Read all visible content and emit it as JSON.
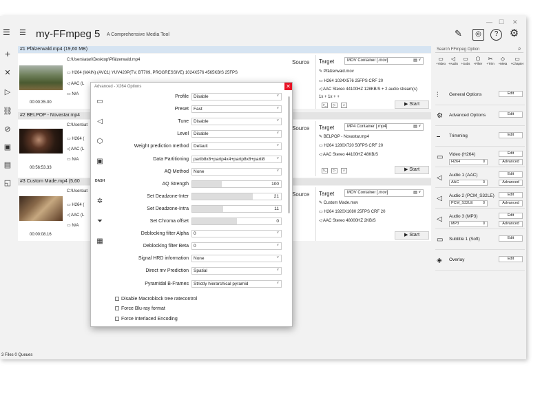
{
  "app": {
    "title": "my-FFmpeg 5",
    "subtitle": "A Comprehensive Media Tool",
    "status": "3 Files 0 Queues"
  },
  "files": [
    {
      "header": "#1  Pfälzerwald.mp4  (19,60 MB)",
      "path": "C:\\Users\\atari\\Desktop\\Pfälzerwald.mp4",
      "video": "H264 (MAIN) (AVC1)  YUV420P(TV, BT709, PROGRESSIVE) 1024X576  4565KB/S 25FPS",
      "audio": "AAC (L",
      "subs": "N/A",
      "duration": "00:00:35.00",
      "source_label": "Source",
      "target": {
        "label": "Target",
        "container": "MOV Container [.mov]",
        "name": "Pfälzerwald.mov",
        "video": "H264 1024X576 25FPS CRF 20",
        "audio": "AAC Stereo 44100HZ 128KB/S + 2 audio stream(s)",
        "extra": "1x      + 1x      +      +",
        "start": "Start"
      }
    },
    {
      "header": "#2  BELPOP - Novastar.mp4",
      "path": "C:\\Users\\at",
      "video": "H264 (",
      "audio": "AAC (L",
      "subs": "N/A",
      "duration": "00:56:53.33",
      "source_label": "Source",
      "target": {
        "label": "Target",
        "container": "MP4 Container [.mp4]",
        "name": "BELPOP - Novastar.mp4",
        "video": "H264 1280X720 50FPS CRF 20",
        "audio": "AAC Stereo 44100HZ 48KB/S",
        "start": "Start"
      }
    },
    {
      "header": "#3  Custom Made.mp4  (5,60",
      "path": "C:\\Users\\at",
      "video": "H264 (",
      "audio": "AAC (L",
      "subs": "N/A",
      "duration": "00:00:08.16",
      "source_label": "Source",
      "target": {
        "label": "Target",
        "container": "MOV Container [.mov]",
        "name": "Custom Made.mov",
        "video": "H264 1920X1080 25FPS CRF 20",
        "audio": "AAC Stereo 48000HZ 2KB/S",
        "start": "Start"
      }
    }
  ],
  "right": {
    "search": "Search FFmpeg Option",
    "tabs": [
      "+Video",
      "+Audio",
      "+Subs",
      "+Filter",
      "+Trim",
      "+Meta",
      "+Chapter"
    ],
    "general": "General Options",
    "advanced": "Advanced Options",
    "trimming": "Trimming",
    "video": {
      "label": "Video (H264)",
      "value": "H264"
    },
    "audio1": {
      "label": "Audio 1 (AAC)",
      "value": "AAC"
    },
    "audio2": {
      "label": "Audio 2 (PCM_S32LE)",
      "value": "PCM_S32LE"
    },
    "audio3": {
      "label": "Audio 3 (MP3)",
      "value": "MP3"
    },
    "subtitle": "Subtitle 1 (Soft)",
    "overlay": "Overlay",
    "edit": "Edit",
    "adv": "Advanced"
  },
  "dialog": {
    "title": "Advanced - X264 Options",
    "rows": [
      {
        "label": "Profile",
        "value": "Disable"
      },
      {
        "label": "Preset",
        "value": "Fast"
      },
      {
        "label": "Tune",
        "value": "Disable"
      },
      {
        "label": "Level",
        "value": "Disable"
      },
      {
        "label": "Weight prediction method",
        "value": "Default"
      },
      {
        "label": "Data Partitioning",
        "value": "partb8x8+partp4x4+partp8x8+parti8"
      },
      {
        "label": "AQ Method",
        "value": "None"
      },
      {
        "label": "AQ Strength",
        "slider": "100",
        "fill": 0.33
      },
      {
        "label": "Set Deadzone-Inter",
        "slider": "21",
        "fill": 0.68
      },
      {
        "label": "Set Deadzone-Intra",
        "slider": "11",
        "fill": 0.35
      },
      {
        "label": "Set Chroma offset",
        "slider": "0",
        "fill": 0.5
      },
      {
        "label": "Deblocking filter Alpha",
        "value": "0"
      },
      {
        "label": "Deblocking filter Beta",
        "value": "0"
      },
      {
        "label": "Signal HRD information",
        "value": "None"
      },
      {
        "label": "Direct mv Prediction",
        "value": "Spatial"
      },
      {
        "label": "Pyramidal B-Frames",
        "value": "Strictly hierarchical pyramid"
      }
    ],
    "checks": [
      "Disable Macroblock tree ratecontrol",
      "Force Blu-ray format",
      "Force Interlaced Encoding"
    ]
  }
}
